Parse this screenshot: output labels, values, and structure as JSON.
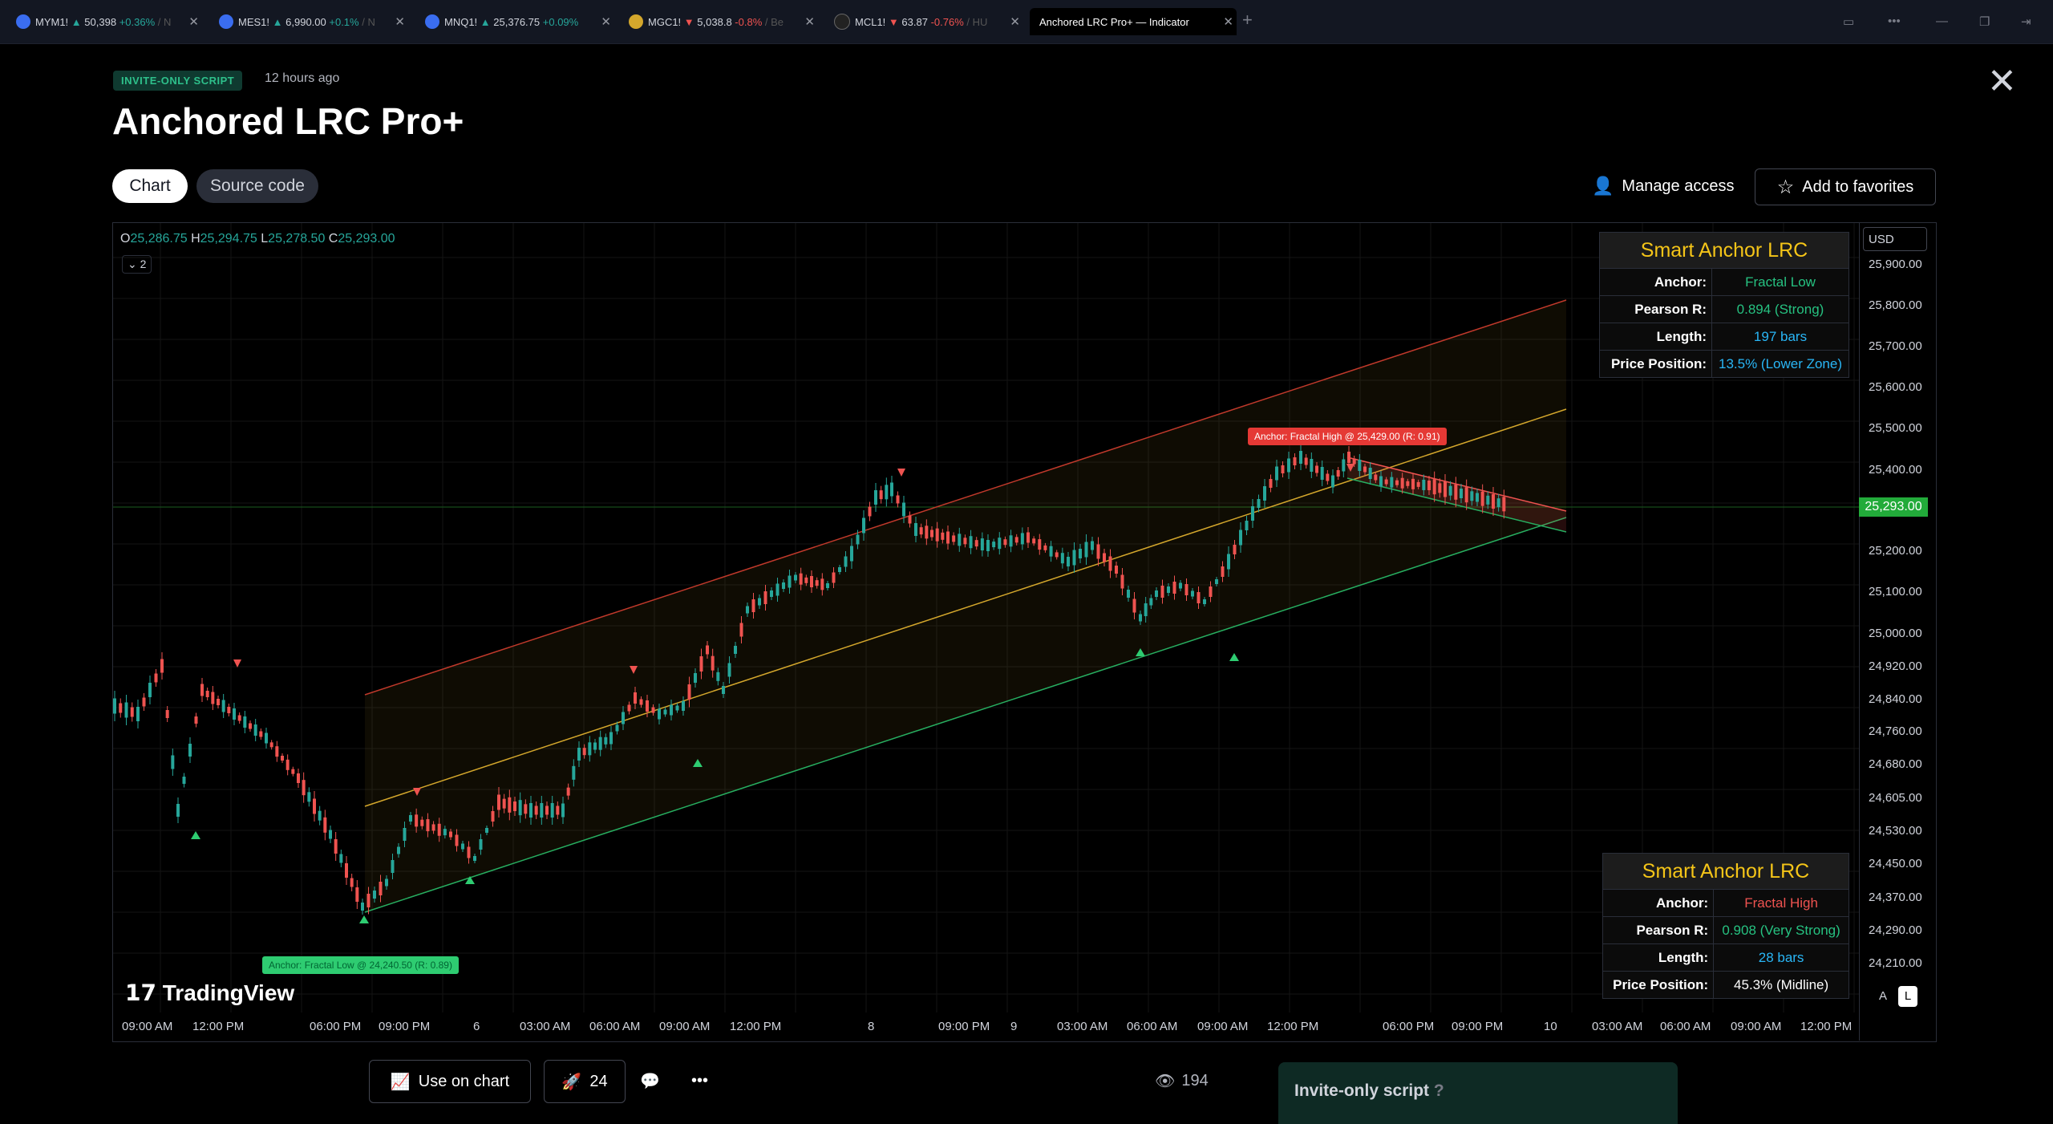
{
  "tabs": [
    {
      "name": "MYM1!",
      "sign": "▲",
      "price": "50,398",
      "change": "+0.36%",
      "extra": "/ N",
      "dir": "up"
    },
    {
      "name": "MES1!",
      "sign": "▲",
      "price": "6,990.00",
      "change": "+0.1%",
      "extra": "/ N",
      "dir": "up"
    },
    {
      "name": "MNQ1!",
      "sign": "▲",
      "price": "25,376.75",
      "change": "+0.09%",
      "extra": "",
      "dir": "up"
    },
    {
      "name": "MGC1!",
      "sign": "▼",
      "price": "5,038.8",
      "change": "-0.8%",
      "extra": "/ Be",
      "dir": "down"
    },
    {
      "name": "MCL1!",
      "sign": "▼",
      "price": "63.87",
      "change": "-0.76%",
      "extra": "/ HU",
      "dir": "down"
    },
    {
      "name": "Anchored LRC Pro+ — Indicator",
      "sign": "",
      "price": "",
      "change": "",
      "extra": "",
      "dir": ""
    }
  ],
  "header": {
    "badge": "INVITE-ONLY SCRIPT",
    "time_ago": "12 hours ago",
    "title": "Anchored LRC Pro+"
  },
  "toggle": {
    "chart": "Chart",
    "source": "Source code"
  },
  "actions": {
    "manage": "Manage access",
    "favorites": "Add to favorites"
  },
  "ohlc": {
    "o": "25,286.75",
    "h": "25,294.75",
    "l": "25,278.50",
    "c": "25,293.00"
  },
  "legend_count": "2",
  "currency": "USD",
  "current_price": "25,293.00",
  "price_axis": [
    "25,900.00",
    "25,800.00",
    "25,700.00",
    "25,600.00",
    "25,500.00",
    "25,400.00",
    "25,200.00",
    "25,100.00",
    "25,000.00",
    "24,920.00",
    "24,840.00",
    "24,760.00",
    "24,680.00",
    "24,605.00",
    "24,530.00",
    "24,450.00",
    "24,370.00",
    "24,290.00",
    "24,210.00"
  ],
  "time_axis": [
    "09:00 AM",
    "12:00 PM",
    "06:00 PM",
    "09:00 PM",
    "6",
    "03:00 AM",
    "06:00 AM",
    "09:00 AM",
    "12:00 PM",
    "8",
    "09:00 PM",
    "9",
    "03:00 AM",
    "06:00 AM",
    "09:00 AM",
    "12:00 PM",
    "06:00 PM",
    "09:00 PM",
    "10",
    "03:00 AM",
    "06:00 AM",
    "09:00 AM",
    "12:00 PM"
  ],
  "anchor_high_label": "Anchor: Fractal High @ 25,429.00 (R: 0.91)",
  "anchor_low_label": "Anchor: Fractal Low @ 24,240.50 (R: 0.89)",
  "watermark": "TradingView",
  "scale_buttons": {
    "a": "A",
    "l": "L"
  },
  "panel_top": {
    "title": "Smart Anchor LRC",
    "rows": [
      {
        "k": "Anchor:",
        "v": "Fractal Low",
        "color": "#26c281"
      },
      {
        "k": "Pearson R:",
        "v": "0.894 (Strong)",
        "color": "#26c281"
      },
      {
        "k": "Length:",
        "v": "197 bars",
        "color": "#29b6f6"
      },
      {
        "k": "Price Position:",
        "v": "13.5% (Lower Zone)",
        "color": "#29b6f6"
      }
    ]
  },
  "panel_bottom": {
    "title": "Smart Anchor LRC",
    "rows": [
      {
        "k": "Anchor:",
        "v": "Fractal High",
        "color": "#ef5350"
      },
      {
        "k": "Pearson R:",
        "v": "0.908 (Very Strong)",
        "color": "#26c281"
      },
      {
        "k": "Length:",
        "v": "28 bars",
        "color": "#29b6f6"
      },
      {
        "k": "Price Position:",
        "v": "45.3% (Midline)",
        "color": "#ffffff"
      }
    ]
  },
  "bottom": {
    "use_on_chart": "Use on chart",
    "boosts": "24",
    "views": "194",
    "invite_title": "Invite-only script"
  },
  "colors": {
    "up": "#26a69a",
    "down": "#ef5350",
    "accent": "#f5c518",
    "channel_top": "#c0392b",
    "channel_mid": "#d4a72c",
    "channel_bot": "#27ae60"
  }
}
